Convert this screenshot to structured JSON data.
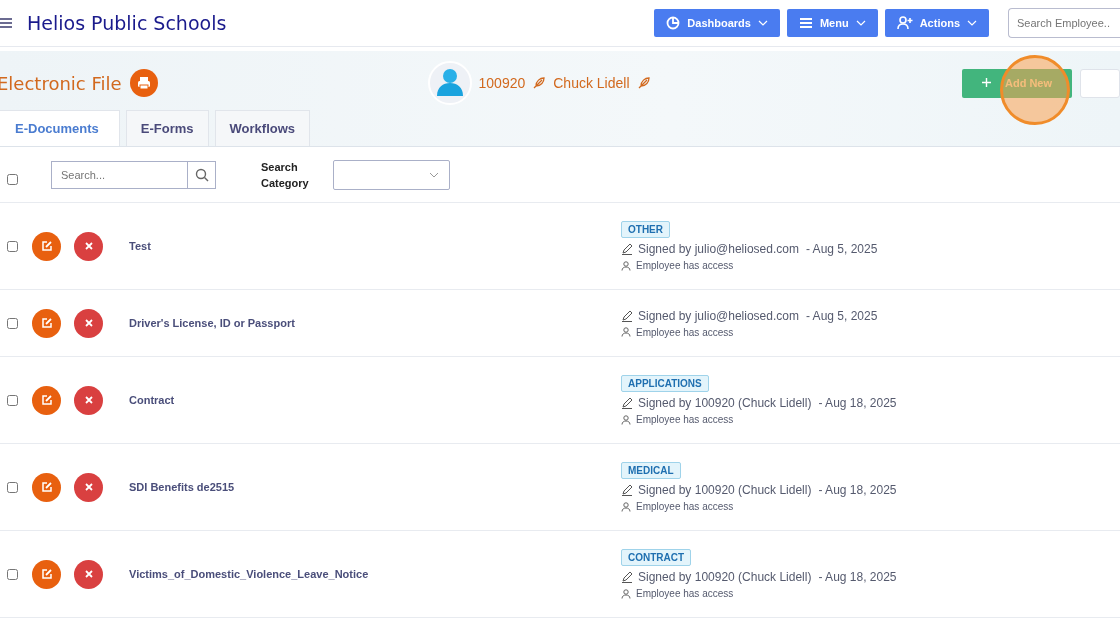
{
  "header": {
    "title": "Helios Public Schools",
    "buttons": [
      {
        "label": "Dashboards"
      },
      {
        "label": "Menu"
      },
      {
        "label": "Actions"
      }
    ],
    "search": {
      "placeholder": "Search Employee.."
    }
  },
  "banner": {
    "title": "Electronic File",
    "employee_id": "100920",
    "employee_name": "Chuck Lidell",
    "add_button": "Add New"
  },
  "tabs": [
    {
      "label": "E-Documents",
      "selected": true
    },
    {
      "label": "E-Forms",
      "selected": false
    },
    {
      "label": "Workflows",
      "selected": false
    }
  ],
  "filter": {
    "select_all": false,
    "search_placeholder": "Search...",
    "category_label": "Search Category"
  },
  "documents": [
    {
      "checked": false,
      "name": "Test",
      "tag": "OTHER",
      "signed": "Signed by julio@heliosed.com",
      "date": "- Aug 5, 2025",
      "access": "Employee has access"
    },
    {
      "checked": false,
      "name": "Driver's License, ID or Passport",
      "signed": "Signed by julio@heliosed.com",
      "date": "- Aug 5, 2025",
      "access": "Employee has access"
    },
    {
      "checked": false,
      "name": "Contract",
      "tag": "APPLICATIONS",
      "signed": "Signed by 100920 (Chuck Lidell)",
      "date": "- Aug 18, 2025",
      "access": "Employee has access"
    },
    {
      "checked": false,
      "name": "SDI Benefits de2515",
      "tag": "MEDICAL",
      "signed": "Signed by 100920 (Chuck Lidell)",
      "date": "- Aug 18, 2025",
      "access": "Employee has access"
    },
    {
      "checked": false,
      "name": "Victims_of_Domestic_Violence_Leave_Notice",
      "tag": "CONTRACT",
      "signed": "Signed by 100920 (Chuck Lidell)",
      "date": "- Aug 18, 2025",
      "access": "Employee has access"
    }
  ]
}
